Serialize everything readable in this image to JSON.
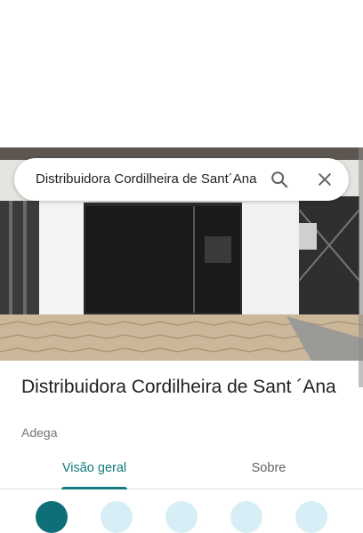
{
  "search": {
    "query": "Distribuidora Cordilheira de Sant´Ana"
  },
  "place": {
    "title": "Distribuidora Cordilheira de Sant ´Ana",
    "category": "Adega"
  },
  "tabs": [
    {
      "label": "Visão geral",
      "active": true
    },
    {
      "label": "Sobre",
      "active": false
    }
  ],
  "icons": {
    "search": "search-icon",
    "close": "close-icon"
  },
  "colors": {
    "accent": "#137a83",
    "action_light": "#d7eef6"
  }
}
